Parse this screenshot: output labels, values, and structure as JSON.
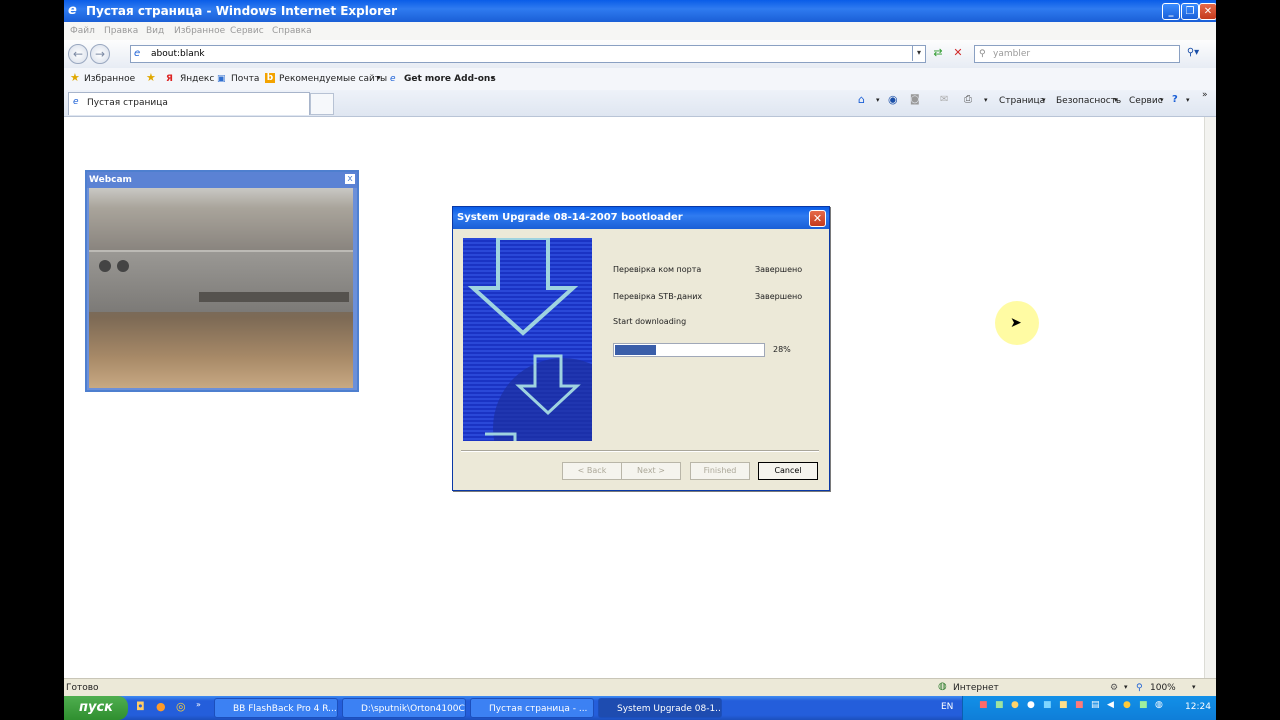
{
  "window": {
    "title": "Пустая страница - Windows Internet Explorer"
  },
  "menubar": [
    "Файл",
    "Правка",
    "Вид",
    "Избранное",
    "Сервис",
    "Справка"
  ],
  "address": {
    "url": "about:blank",
    "search_placeholder": "yambler"
  },
  "favorites": {
    "label": "Избранное",
    "items": [
      "Яндекс",
      "Почта",
      "Рекомендуемые сайты",
      "Get more Add-ons"
    ]
  },
  "tab": {
    "title": "Пустая страница"
  },
  "commandbar": {
    "page": "Страница",
    "safety": "Безопасность",
    "tools": "Сервис"
  },
  "webcam": {
    "title": "Webcam",
    "close": "x"
  },
  "dialog": {
    "title": "System Upgrade 08-14-2007 bootloader",
    "steps": [
      {
        "label": "Перевірка ком порта",
        "status": "Завершено"
      },
      {
        "label": "Перевірка STB-даних",
        "status": "Завершено"
      },
      {
        "label": "Start downloading",
        "status": ""
      }
    ],
    "progress": 28,
    "progress_text": "28%",
    "buttons": {
      "back": "< Back",
      "next": "Next >",
      "finished": "Finished",
      "cancel": "Cancel"
    }
  },
  "status": {
    "left": "Готово",
    "zone": "Интернет",
    "zoom": "100%"
  },
  "taskbar": {
    "start": "пуск",
    "items": [
      "BB FlashBack Pro 4 R...",
      "D:\\sputnik\\Orton4100C",
      "Пустая страница - ...",
      "System Upgrade 08-1..."
    ],
    "lang": "EN",
    "clock": "12:24"
  }
}
